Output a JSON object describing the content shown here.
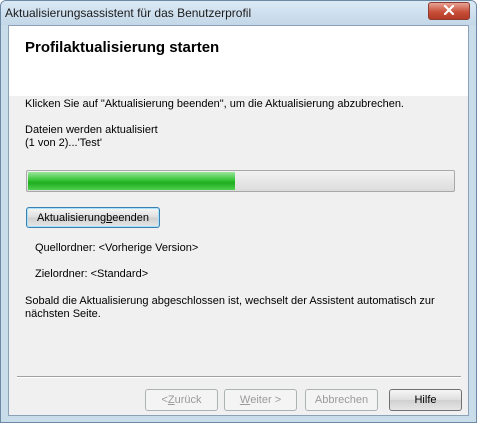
{
  "window": {
    "title": "Aktualisierungsassistent für das Benutzerprofil",
    "close_icon": "close-icon"
  },
  "page": {
    "heading": "Profilaktualisierung starten",
    "instruction": "Klicken Sie auf \"Aktualisierung beenden\", um die Aktualisierung abzubrechen.",
    "status_line1": "Dateien werden aktualisiert",
    "status_line2": "(1 von 2)...'Test'",
    "progress_fraction": 0.485,
    "stop_button": {
      "before": "Aktualisierung ",
      "access": "b",
      "after": "eenden"
    },
    "source_folder": "Quellordner: <Vorherige Version>",
    "target_folder": "Zielordner: <Standard>",
    "info_line1": "Sobald die Aktualisierung abgeschlossen ist, wechselt der Assistent automatisch zur",
    "info_line2": "nächsten Seite."
  },
  "buttons": {
    "back": {
      "before": "< ",
      "access": "Z",
      "after": "urück"
    },
    "next": {
      "before": "",
      "access": "W",
      "after": "eiter >"
    },
    "cancel": "Abbrechen",
    "help": "Hilfe"
  },
  "colors": {
    "progress_fill": "#36c436",
    "title_bar": "#c9dcea",
    "close_button": "#c8503a"
  }
}
